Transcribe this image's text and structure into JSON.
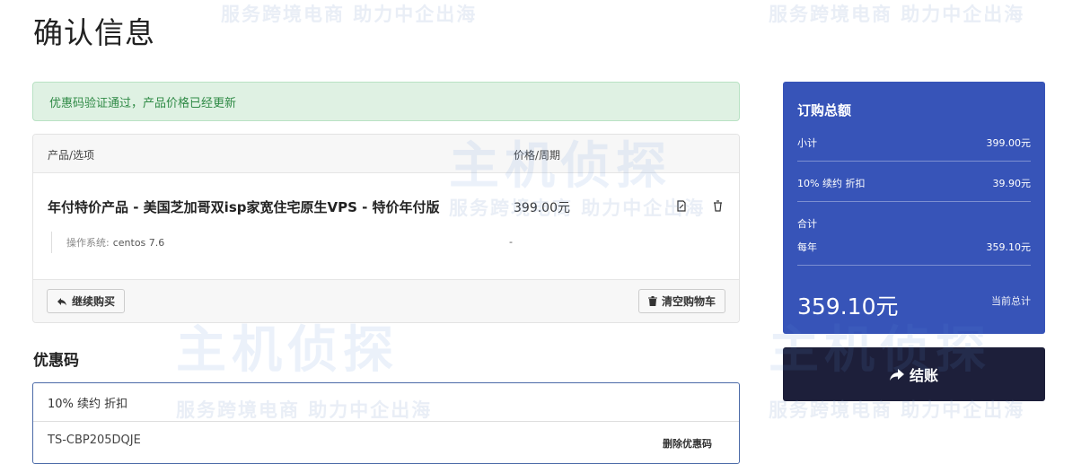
{
  "page": {
    "title": "确认信息"
  },
  "alert": {
    "message": "优惠码验证通过，产品价格已经更新"
  },
  "cart": {
    "headers": {
      "product": "产品/选项",
      "price": "价格/周期"
    },
    "item": {
      "name": "年付特价产品 - 美国芝加哥双isp家宽住宅原生VPS - 特价年付版",
      "price": "399.00元",
      "option_label": "操作系统:",
      "option_value": "centos 7.6",
      "option_price": "-"
    },
    "buttons": {
      "continue": "继续购买",
      "clear": "清空购物车"
    }
  },
  "promo": {
    "title": "优惠码",
    "name": "10% 续约 折扣",
    "code": "TS-CBP205DQJE",
    "remove": "删除优惠码"
  },
  "summary": {
    "title": "订购总额",
    "subtotal_label": "小计",
    "subtotal_value": "399.00元",
    "discount_label": "10% 续约 折扣",
    "discount_value": "39.90元",
    "total_label": "合计",
    "cycle_label": "每年",
    "cycle_value": "359.10元",
    "grand_total": "359.10元",
    "grand_total_note": "当前总计"
  },
  "checkout": {
    "label": "结账"
  },
  "watermark": {
    "brand": "主机侦探",
    "slogan": "服务跨境电商 助力中企出海"
  },
  "colors": {
    "summary_bg": "#3754b8",
    "checkout_bg": "#1d1f3a",
    "alert_bg": "#dff1e3",
    "alert_text": "#2f8a46"
  }
}
